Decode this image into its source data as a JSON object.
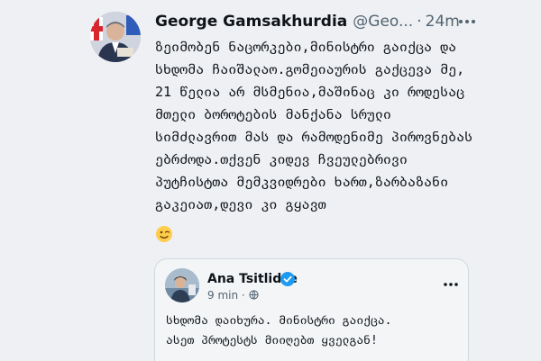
{
  "tweet": {
    "author_name": "George Gamsakhurdia",
    "handle": "@Geo...",
    "separator": "·",
    "time": "24m",
    "text": "ზეიმობენ ნაცორკები,მინისტრი გაიქცა და სხდომა ჩაიშალაო.გომეიაურის გაქცევა მე, 21 წელია არ მსმენია,მაშინაც კი როდესაც მთელი ბოროტების მანქანა სრული სიმძლავრით მას და რამოდენიმე პიროვნებას ებრძოდა.თქვენ კიდევ ჩვეულებრივი პუტჩისტთა მემკვიდრები ხართ,ზარბაზანი გაკეიათ,დევი კი გყავთ",
    "emoji_icon": "winking-face-emoji",
    "more_icon": "more-options-icon",
    "avatar_icon": "profile-photo-avatar"
  },
  "quoted_tweet": {
    "author_name": "Ana Tsitlidze",
    "time": "9 min",
    "separator": "·",
    "verified_icon": "verified-badge-icon",
    "more_icon": "more-options-icon",
    "text_line1": "სხდომა დაიხურა. მინისტრი გაიქცა.",
    "text_line2": "ასეთ პროტესტს მიიღებთ ყველგან!"
  },
  "colors": {
    "background": "#eef0f3",
    "text": "#0f1419",
    "secondary_text": "#536471",
    "verified": "#1d9bf0",
    "quote_border": "#cfd9de"
  }
}
